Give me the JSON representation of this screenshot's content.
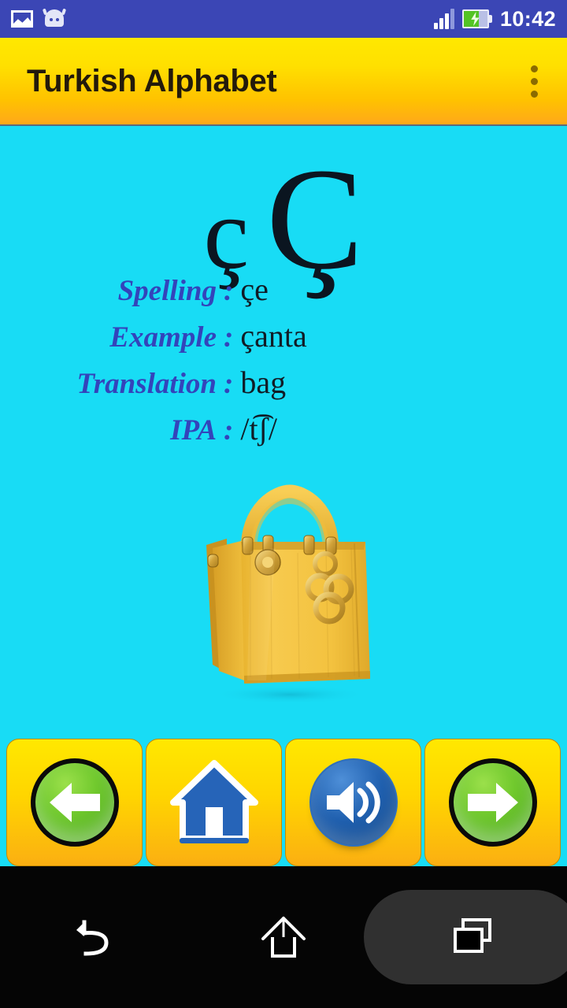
{
  "status_bar": {
    "clock": "10:42",
    "icons": [
      "photo-icon",
      "android-head-icon",
      "signal-icon",
      "battery-charging-icon"
    ],
    "background_color": "#3B46B5",
    "signal_bars_filled": 3,
    "signal_bars_total": 4,
    "battery_charging": true
  },
  "title_bar": {
    "title": "Turkish Alphabet",
    "overflow_label": "⋮",
    "gradient_from": "#FFE800",
    "gradient_to": "#FFA81A",
    "title_color": "#231A0B"
  },
  "letter_card": {
    "lowercase": "ç",
    "uppercase": "Ç",
    "letter_color": "#0B1520"
  },
  "details": {
    "label_color": "#3344BB",
    "value_color": "#111C26",
    "colon": ":",
    "rows": [
      {
        "label": "Spelling",
        "value": "çe"
      },
      {
        "label": "Example",
        "value": "çanta"
      },
      {
        "label": "Translation",
        "value": "bag"
      },
      {
        "label": "IPA",
        "value": "/t͡ʃ/"
      }
    ]
  },
  "illustration": {
    "name": "yellow-handbag-image",
    "alt": "yellow leather handbag with gold hardware",
    "bag_color": "#F5C23B",
    "hardware_color": "#D9A441"
  },
  "button_bar": {
    "background_from": "#FFE800",
    "background_to": "#FBAF12",
    "buttons": [
      {
        "name": "previous-button",
        "icon": "arrow-left-icon",
        "color": "green"
      },
      {
        "name": "home-button",
        "icon": "house-icon",
        "color": "blue"
      },
      {
        "name": "sound-button",
        "icon": "speaker-icon",
        "color": "blue"
      },
      {
        "name": "next-button",
        "icon": "arrow-right-icon",
        "color": "green"
      }
    ]
  },
  "system_nav": {
    "background_color": "#050505",
    "buttons": [
      {
        "name": "system-back-button",
        "icon": "back-arrow-icon",
        "highlighted": false
      },
      {
        "name": "system-home-button",
        "icon": "home-outline-icon",
        "highlighted": false
      },
      {
        "name": "system-recents-button",
        "icon": "recents-squares-icon",
        "highlighted": true
      }
    ]
  },
  "page_background": "#18DCF5"
}
